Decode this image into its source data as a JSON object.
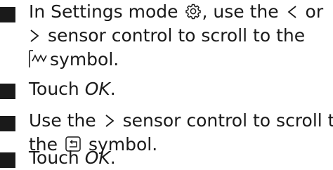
{
  "steps": [
    {
      "line1_a": "In Settings mode",
      "line1_b": ", use the",
      "line1_c": "or",
      "line2_a": "sensor control to scroll to the",
      "line3_a": "symbol."
    },
    {
      "a": "Touch",
      "b": "OK",
      "c": "."
    },
    {
      "line1_a": "Use the",
      "line1_b": "sensor control to scroll to",
      "line2_a": "the",
      "line2_b": "symbol."
    },
    {
      "a": "Touch",
      "b": "OK",
      "c": "."
    }
  ],
  "icons": {
    "settings": "gear-icon",
    "left": "less-than-arrow-icon",
    "right": "greater-than-arrow-icon",
    "function": "sensor-symbol-icon",
    "memory": "memory-symbol-icon"
  }
}
